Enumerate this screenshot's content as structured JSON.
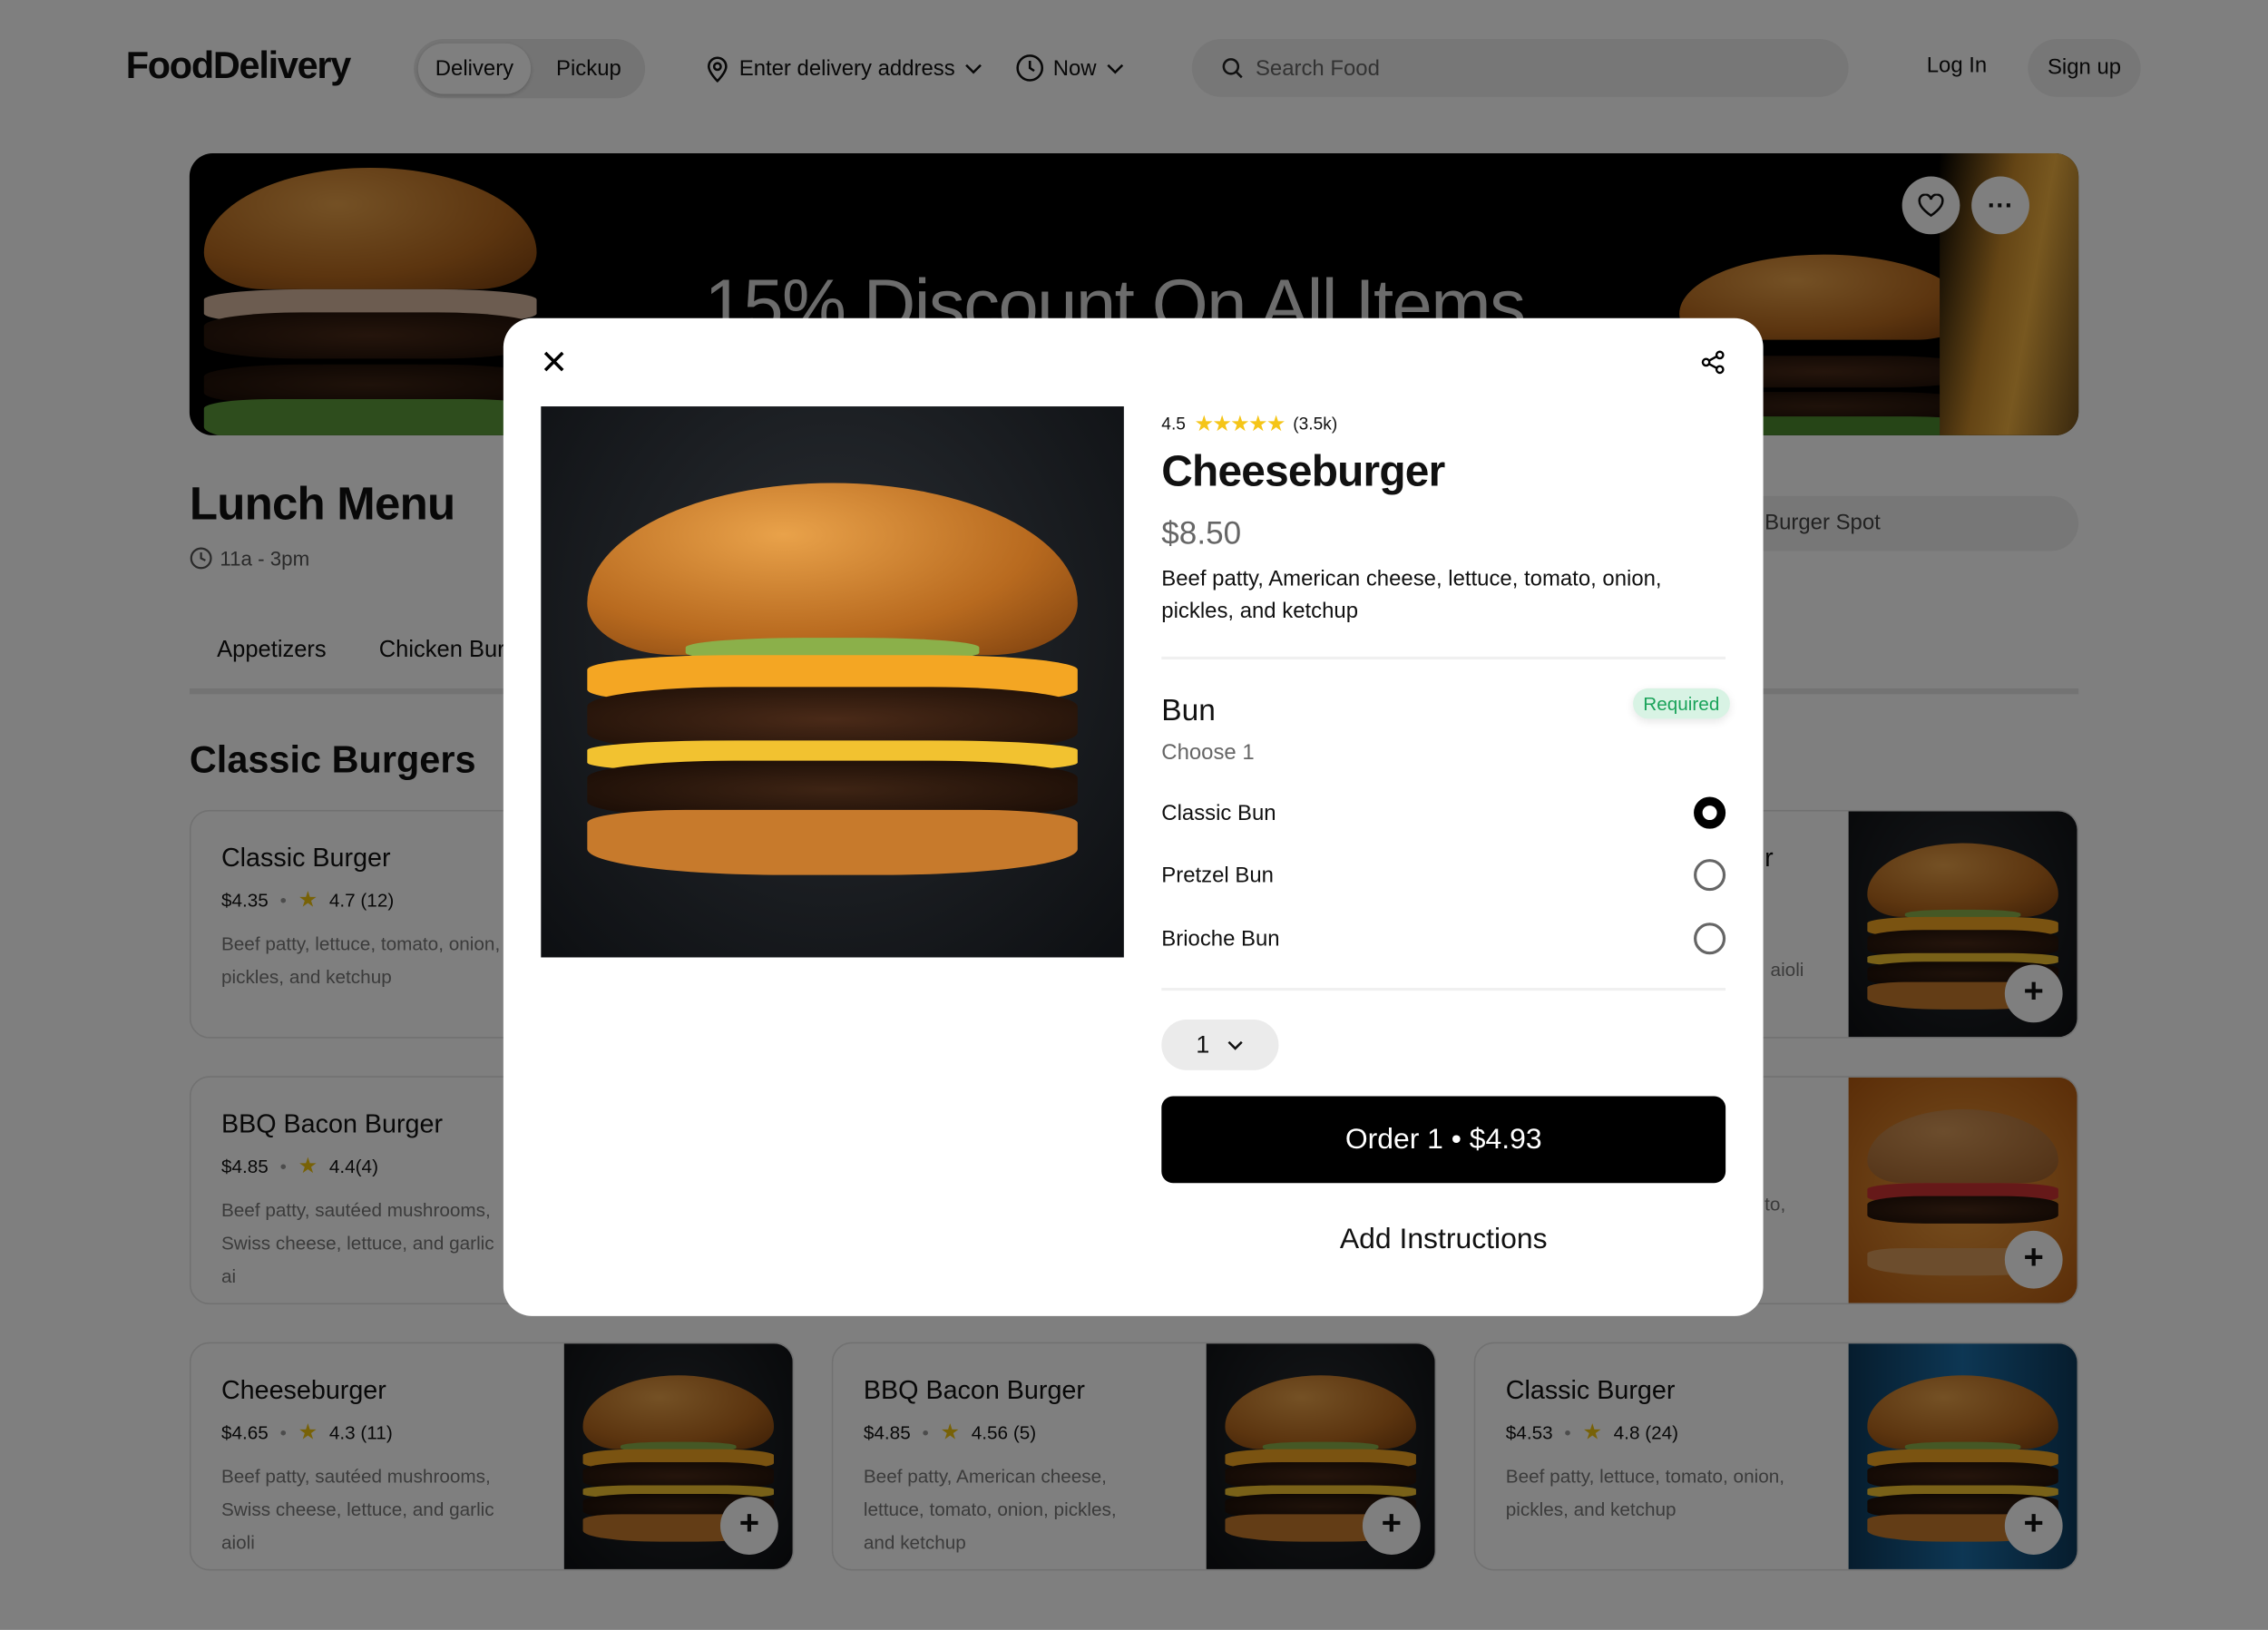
{
  "header": {
    "logo": "FoodDelivery",
    "mode_toggle": {
      "options": [
        "Delivery",
        "Pickup"
      ],
      "selected": "Delivery"
    },
    "address": "Enter delivery address",
    "time": "Now",
    "search_placeholder": "Search Food",
    "login": "Log In",
    "signup": "Sign up"
  },
  "banner": {
    "text": "15% Discount On All Items"
  },
  "menu": {
    "title": "Lunch Menu",
    "hours": "11a - 3pm",
    "tabs": [
      "Appetizers",
      "Chicken Burg"
    ],
    "store_search_visible_text": "Burger Spot",
    "section": "Classic Burgers",
    "peek_fragments": [
      "r",
      "aioli",
      ",",
      "to,"
    ],
    "cards": [
      {
        "title": "Classic Burger",
        "price": "$4.35",
        "rating": "4.7 (12)",
        "desc": "Beef patty, lettuce, tomato, onion, pickles, and ketchup"
      },
      {
        "title": "BBQ Bacon Burger",
        "price": "$4.85",
        "rating": "4.4(4)",
        "desc": "Beef patty, sautéed mushrooms, Swiss cheese, lettuce, and garlic ai"
      },
      {
        "title": "Cheeseburger",
        "price": "$4.65",
        "rating": "4.3 (11)",
        "desc": "Beef patty, sautéed mushrooms, Swiss cheese, lettuce, and garlic aioli"
      },
      {
        "title": "BBQ Bacon Burger",
        "price": "$4.85",
        "rating": "4.56 (5)",
        "desc": "Beef patty, American cheese, lettuce, tomato, onion, pickles, and ketchup"
      },
      {
        "title": "Classic Burger",
        "price": "$4.53",
        "rating": "4.8 (24)",
        "desc": "Beef patty, lettuce, tomato, onion, pickles, and ketchup"
      }
    ]
  },
  "modal": {
    "rating": "4.5",
    "stars": 5,
    "rating_count": "(3.5k)",
    "title": "Cheeseburger",
    "price": "$8.50",
    "description": "Beef patty, American cheese, lettuce, tomato, onion, pickles, and ketchup",
    "option_group": {
      "title": "Bun",
      "badge": "Required",
      "subtitle": "Choose 1",
      "options": [
        "Classic Bun",
        "Pretzel Bun",
        "Brioche Bun"
      ],
      "selected": "Classic Bun"
    },
    "quantity": "1",
    "order_button": "Order 1 • $4.93",
    "add_instructions": "Add Instructions"
  },
  "colors": {
    "accent": "#000000",
    "required_green": "#1aa35a",
    "star": "#f5c518",
    "overlay": "rgba(0,0,0,0.5)"
  }
}
